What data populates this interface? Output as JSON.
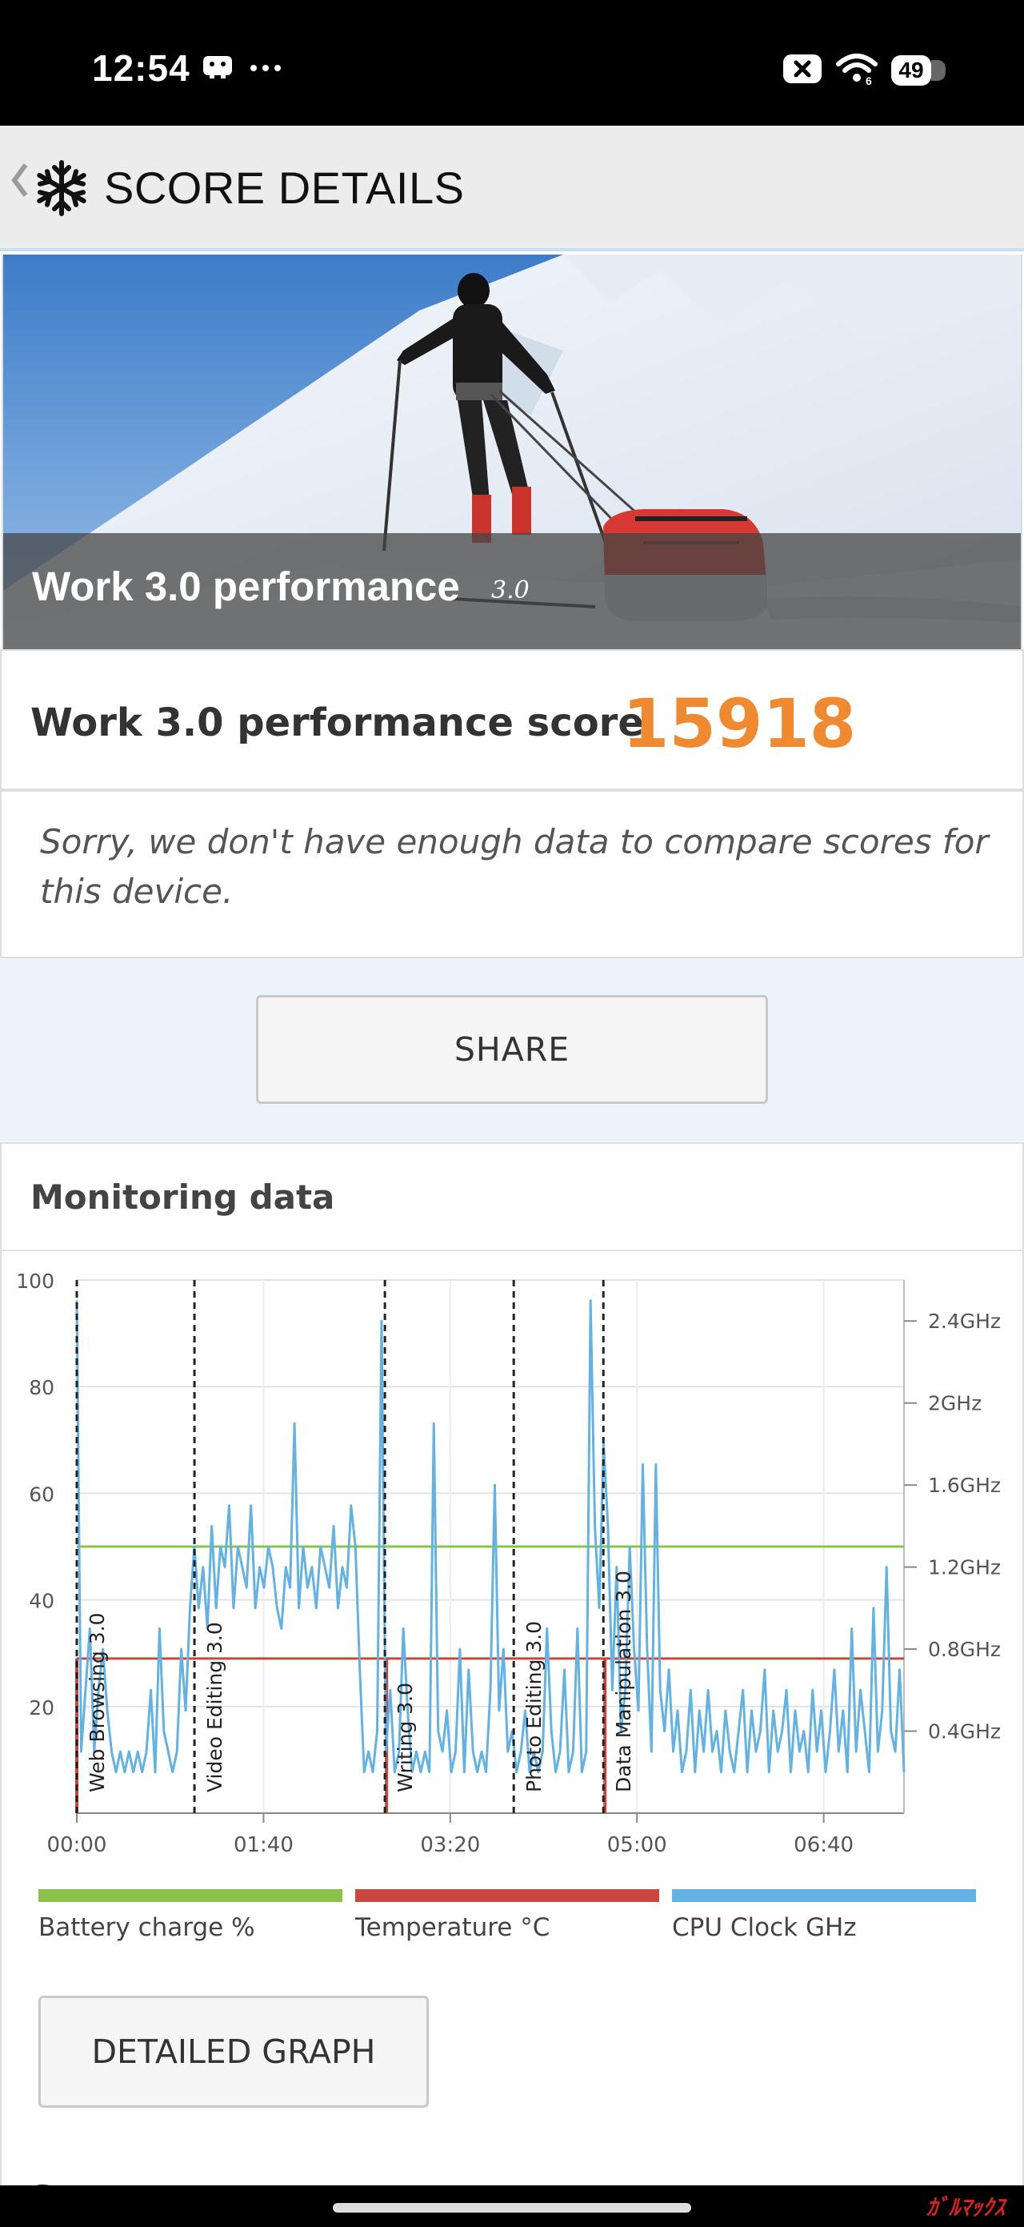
{
  "status_bar": {
    "time": "12:54",
    "battery": "49",
    "icons": [
      "game-controller-icon",
      "more-dots-icon",
      "close-box-icon",
      "wifi-icon",
      "battery-icon"
    ]
  },
  "header": {
    "title": "SCORE DETAILS",
    "back_icon": "chevron-left-icon",
    "logo_icon": "snowflake-icon"
  },
  "hero": {
    "title": "Work 3.0 performance",
    "version": "3.0"
  },
  "score": {
    "label": "Work 3.0 performance score",
    "value": "15918",
    "value_color": "#f08a31"
  },
  "compare_message": "Sorry, we don't have enough data to compare scores for this device.",
  "share_button": "SHARE",
  "monitoring": {
    "title": "Monitoring data",
    "detailed_graph_button": "DETAILED GRAPH",
    "next_section_title": "Scores"
  },
  "chart_data": {
    "type": "line",
    "x_ticks": [
      "00:00",
      "01:40",
      "03:20",
      "05:00",
      "06:40"
    ],
    "x_range_seconds": [
      0,
      443
    ],
    "y_left_ticks": [
      "20",
      "40",
      "60",
      "80",
      "100"
    ],
    "y_left_range": [
      0,
      100
    ],
    "y_right_ticks": [
      "0.4GHz",
      "0.8GHz",
      "1.2GHz",
      "1.6GHz",
      "2GHz",
      "2.4GHz"
    ],
    "y_right_range_ghz": [
      0,
      2.6
    ],
    "grid": true,
    "phase_markers": [
      {
        "label": "Web Browsing 3.0",
        "t": 0
      },
      {
        "label": "Video Editing 3.0",
        "t": 63
      },
      {
        "label": "Writing 3.0",
        "t": 165
      },
      {
        "label": "Photo Editing 3.0",
        "t": 234
      },
      {
        "label": "Data Manipulation 3.0",
        "t": 282
      }
    ],
    "series": [
      {
        "name": "Battery charge %",
        "color": "#8bc34a",
        "axis": "left",
        "points": [
          [
            0,
            50
          ],
          [
            443,
            50
          ]
        ]
      },
      {
        "name": "Temperature °C",
        "color": "#c9473f",
        "axis": "left",
        "points": [
          [
            0,
            29
          ],
          [
            443,
            29
          ]
        ]
      },
      {
        "name": "CPU Clock GHz",
        "color": "#62b2e4",
        "axis": "right",
        "values": [
          2.5,
          0.3,
          0.6,
          0.9,
          0.3,
          0.6,
          0.8,
          0.5,
          0.3,
          0.2,
          0.3,
          0.2,
          0.3,
          0.2,
          0.3,
          0.2,
          0.3,
          0.6,
          0.2,
          0.9,
          0.4,
          0.3,
          0.2,
          0.3,
          0.8,
          0.5,
          1.0,
          1.3,
          1.0,
          1.2,
          0.9,
          1.4,
          1.0,
          1.3,
          1.2,
          1.5,
          1.0,
          1.3,
          1.2,
          1.1,
          1.5,
          1.0,
          1.2,
          1.1,
          1.3,
          1.2,
          1.0,
          0.9,
          1.2,
          1.1,
          1.9,
          1.0,
          1.3,
          1.1,
          1.2,
          1.0,
          1.3,
          1.2,
          1.1,
          1.4,
          1.0,
          1.2,
          1.1,
          1.5,
          1.3,
          0.7,
          0.2,
          0.3,
          0.2,
          0.4,
          2.4,
          0.3,
          0.6,
          0.2,
          0.3,
          0.9,
          0.5,
          0.2,
          0.3,
          0.2,
          0.3,
          0.2,
          1.9,
          0.4,
          0.3,
          0.5,
          0.2,
          0.3,
          0.8,
          0.2,
          0.7,
          0.3,
          0.2,
          0.3,
          0.2,
          0.6,
          1.6,
          0.5,
          0.8,
          0.3,
          0.4,
          0.2,
          0.3,
          0.5,
          0.2,
          0.3,
          0.2,
          0.3,
          0.9,
          0.4,
          0.2,
          0.3,
          0.7,
          0.2,
          0.3,
          0.9,
          0.2,
          0.3,
          2.5,
          1.4,
          1.0,
          1.8,
          1.4,
          0.6,
          1.2,
          0.4,
          0.6,
          1.3,
          0.8,
          0.5,
          1.7,
          0.8,
          0.3,
          1.7,
          0.6,
          0.4,
          0.7,
          0.3,
          0.5,
          0.2,
          0.3,
          0.6,
          0.2,
          0.5,
          0.3,
          0.6,
          0.3,
          0.4,
          0.2,
          0.5,
          0.3,
          0.2,
          0.4,
          0.6,
          0.2,
          0.5,
          0.3,
          0.4,
          0.7,
          0.2,
          0.5,
          0.3,
          0.4,
          0.6,
          0.2,
          0.5,
          0.3,
          0.4,
          0.2,
          0.6,
          0.3,
          0.5,
          0.2,
          0.4,
          0.7,
          0.3,
          0.5,
          0.2,
          0.9,
          0.3,
          0.6,
          0.4,
          0.2,
          1.0,
          0.3,
          0.5,
          1.2,
          0.4,
          0.3,
          0.7,
          0.2
        ]
      }
    ]
  }
}
